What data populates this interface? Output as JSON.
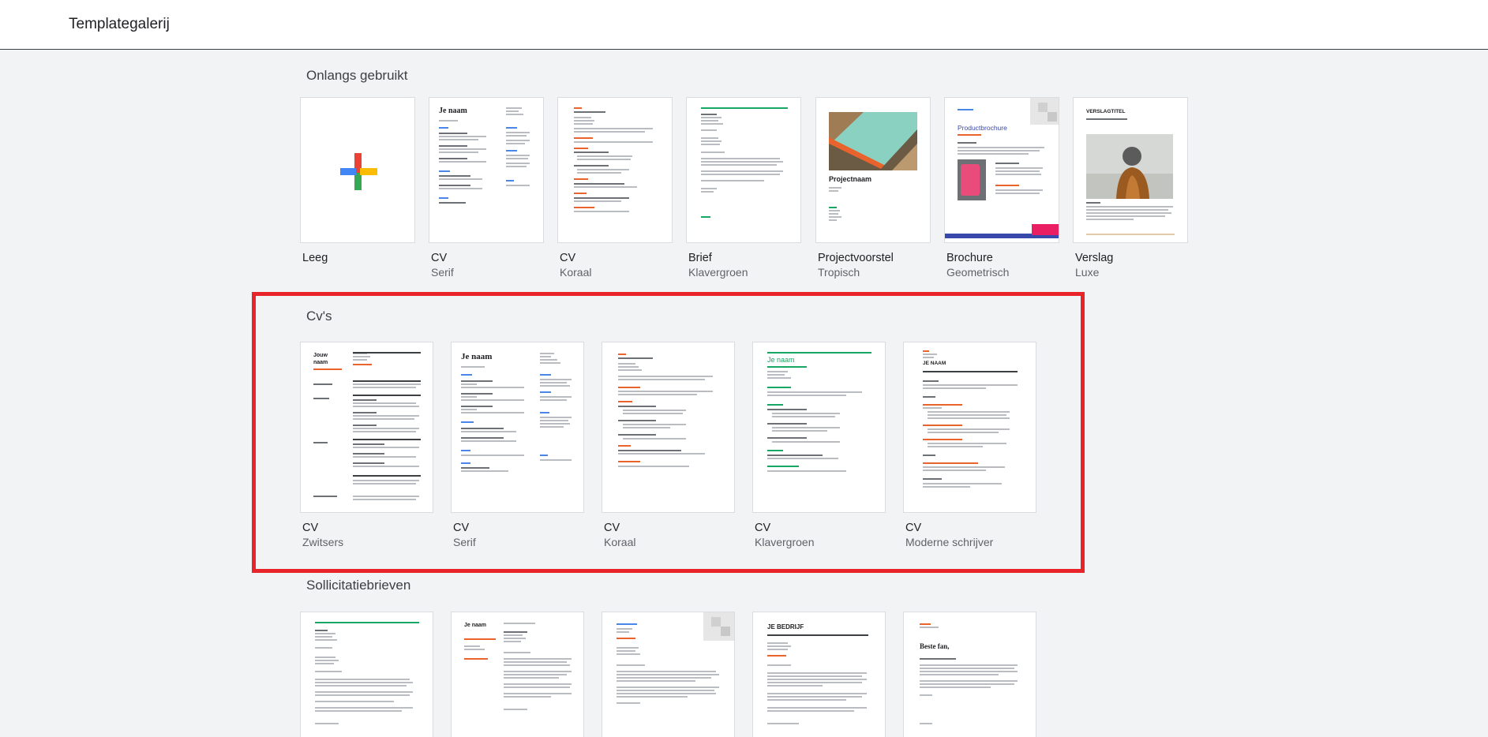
{
  "header": {
    "title": "Templategalerij"
  },
  "sections": {
    "recent": {
      "title": "Onlangs gebruikt",
      "items": [
        {
          "name": "Leeg",
          "sub": ""
        },
        {
          "name": "CV",
          "sub": "Serif"
        },
        {
          "name": "CV",
          "sub": "Koraal"
        },
        {
          "name": "Brief",
          "sub": "Klavergroen"
        },
        {
          "name": "Projectvoorstel",
          "sub": "Tropisch"
        },
        {
          "name": "Brochure",
          "sub": "Geometrisch"
        },
        {
          "name": "Verslag",
          "sub": "Luxe"
        }
      ]
    },
    "cvs": {
      "title": "Cv's",
      "items": [
        {
          "name": "CV",
          "sub": "Zwitsers"
        },
        {
          "name": "CV",
          "sub": "Serif"
        },
        {
          "name": "CV",
          "sub": "Koraal"
        },
        {
          "name": "CV",
          "sub": "Klavergroen"
        },
        {
          "name": "CV",
          "sub": "Moderne schrijver"
        }
      ]
    },
    "letters": {
      "title": "Sollicitatiebrieven"
    }
  },
  "thumbnail_text": {
    "je_naam": "Je naam",
    "jouw_naam": "Jouw naam",
    "projectnaam": "Projectnaam",
    "productbrochure": "Productbrochure",
    "verslagtitel": "VERSLAGTITEL",
    "je_bedrijf": "JE BEDRIJF",
    "jij_naam": "JE NAAM",
    "beste_fan": "Beste fan,"
  },
  "colors": {
    "highlight": "#e8232a",
    "plus_red": "#ea4335",
    "plus_blue": "#4285f4",
    "plus_yellow": "#fbbc04",
    "plus_green": "#34a853"
  }
}
